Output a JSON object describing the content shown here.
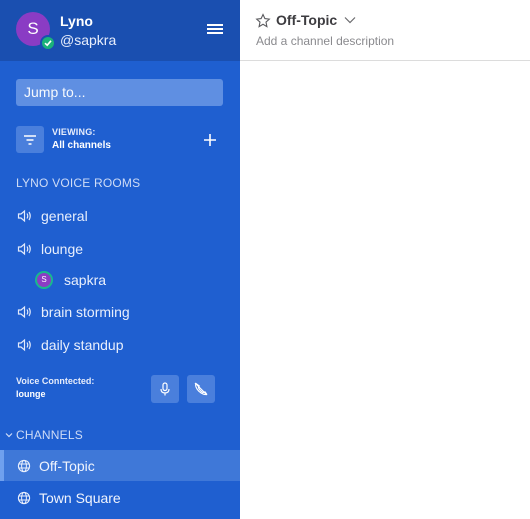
{
  "team": {
    "avatar_letter": "S",
    "name": "Lyno",
    "username": "@sapkra"
  },
  "search": {
    "placeholder": "Jump to..."
  },
  "filter": {
    "viewing_label": "VIEWING:",
    "viewing_value": "All channels"
  },
  "voice_rooms": {
    "title": "LYNO VOICE ROOMS",
    "rooms": [
      {
        "label": "general"
      },
      {
        "label": "lounge"
      },
      {
        "label": "brain storming"
      },
      {
        "label": "daily standup"
      }
    ],
    "member": {
      "avatar_letter": "S",
      "name": "sapkra"
    }
  },
  "voice_status": {
    "label": "Voice Conntected:",
    "room": "lounge"
  },
  "channels": {
    "title": "CHANNELS",
    "items": [
      {
        "label": "Off-Topic",
        "active": true
      },
      {
        "label": "Town Square",
        "active": false
      }
    ]
  },
  "channel_header": {
    "title": "Off-Topic",
    "description": "Add a channel description"
  },
  "colors": {
    "sidebar": "#1f5fd0",
    "sidebar_header": "#1a4fb0",
    "active_channel": "#3f78d8",
    "online": "#1bb27a",
    "avatar": "#8a3cc4"
  },
  "icons": [
    "menu-icon",
    "filter-icon",
    "plus-icon",
    "speaker-icon",
    "microphone-icon",
    "hangup-icon",
    "chevron-down-icon",
    "globe-icon",
    "star-icon",
    "check-icon"
  ]
}
